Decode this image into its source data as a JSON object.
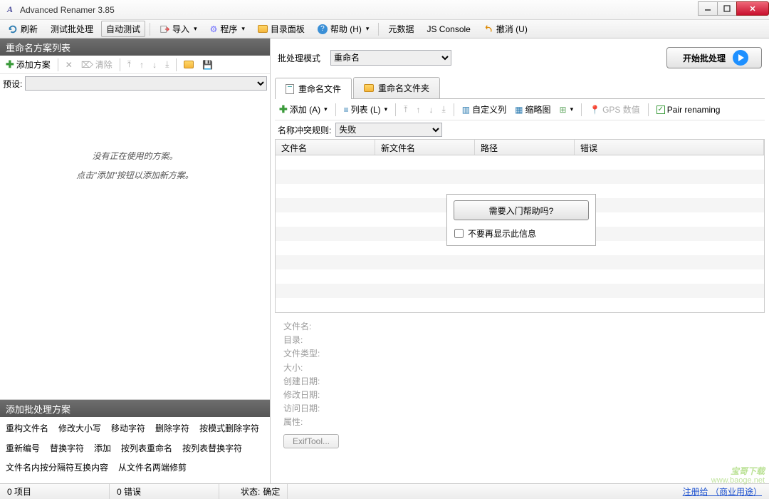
{
  "window": {
    "title": "Advanced Renamer 3.85"
  },
  "toolbar": {
    "refresh": "刷新",
    "test_batch": "测试批处理",
    "auto_test": "自动测试",
    "import": "导入",
    "program": "程序",
    "folder_panel": "目录面板",
    "help": "帮助 (H)",
    "metadata": "元数据",
    "js_console": "JS Console",
    "undo": "撤消 (U)"
  },
  "left": {
    "header": "重命名方案列表",
    "add_method": "添加方案",
    "clear": "清除",
    "preset_label": "预设:",
    "empty_msg1": "没有正在使用的方案。",
    "empty_msg2": "点击\"添加\"按钮以添加新方案。",
    "bottom_header": "添加批处理方案",
    "methods": [
      "重构文件名",
      "修改大小写",
      "移动字符",
      "删除字符",
      "按模式删除字符",
      "重新编号",
      "替换字符",
      "添加",
      "按列表重命名",
      "按列表替换字符",
      "文件名内按分隔符互换内容",
      "从文件名两端修剪"
    ]
  },
  "right": {
    "mode_label": "批处理模式",
    "mode_value": "重命名",
    "start_btn": "开始批处理",
    "tab_files": "重命名文件",
    "tab_folders": "重命名文件夹",
    "file_tb": {
      "add": "添加 (A)",
      "list": "列表 (L)",
      "custom_cols": "自定义列",
      "thumbnails": "缩略图",
      "gps": "GPS 数值",
      "pair": "Pair renaming"
    },
    "conflict_label": "名称冲突规则:",
    "conflict_value": "失败",
    "columns": {
      "c1": "文件名",
      "c2": "新文件名",
      "c3": "路径",
      "c4": "错误"
    },
    "help_popup": {
      "btn": "需要入门帮助吗?",
      "dont_show": "不要再显示此信息"
    },
    "details": {
      "filename": "文件名:",
      "dir": "目录:",
      "filetype": "文件类型:",
      "size": "大小:",
      "created": "创建日期:",
      "modified": "修改日期:",
      "accessed": "访问日期:",
      "attr": "属性:",
      "exif_btn": "ExifTool..."
    }
  },
  "status": {
    "items": "0 项目",
    "errors": "0 错误",
    "state_label": "状态:",
    "state_value": "确定",
    "register": "注册给 （商业用途）"
  },
  "watermark": {
    "big": "宝哥下载",
    "small": "www.baoge.net"
  }
}
